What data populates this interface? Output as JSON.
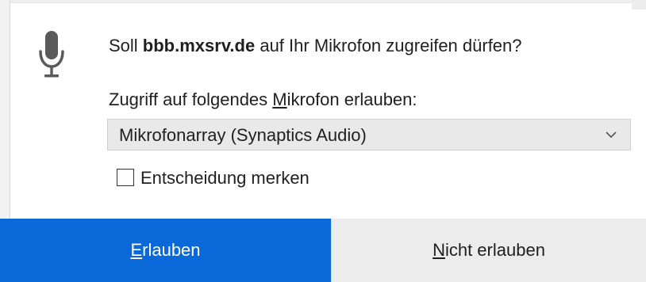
{
  "prompt": {
    "prefix": "Soll ",
    "host": "bbb.mxsrv.de",
    "suffix": " auf Ihr Mikrofon zugreifen dürfen?"
  },
  "select_label": {
    "before": "Zugriff auf folgendes ",
    "accesskey": "M",
    "after": "ikrofon erlauben:"
  },
  "device_select": {
    "value": "Mikrofonarray (Synaptics Audio)"
  },
  "remember": {
    "label": "Entscheidung merken",
    "checked": false
  },
  "buttons": {
    "allow": {
      "accesskey": "E",
      "rest": "rlauben"
    },
    "deny": {
      "accesskey": "N",
      "rest": "icht erlauben"
    }
  },
  "icons": {
    "mic": "microphone-icon",
    "dropdown": "chevron-down-icon"
  },
  "colors": {
    "allow_bg": "#0a68d8",
    "deny_bg": "#ececec",
    "dropdown_bg": "#e9e9e9",
    "icon": "#5a5a5a"
  }
}
